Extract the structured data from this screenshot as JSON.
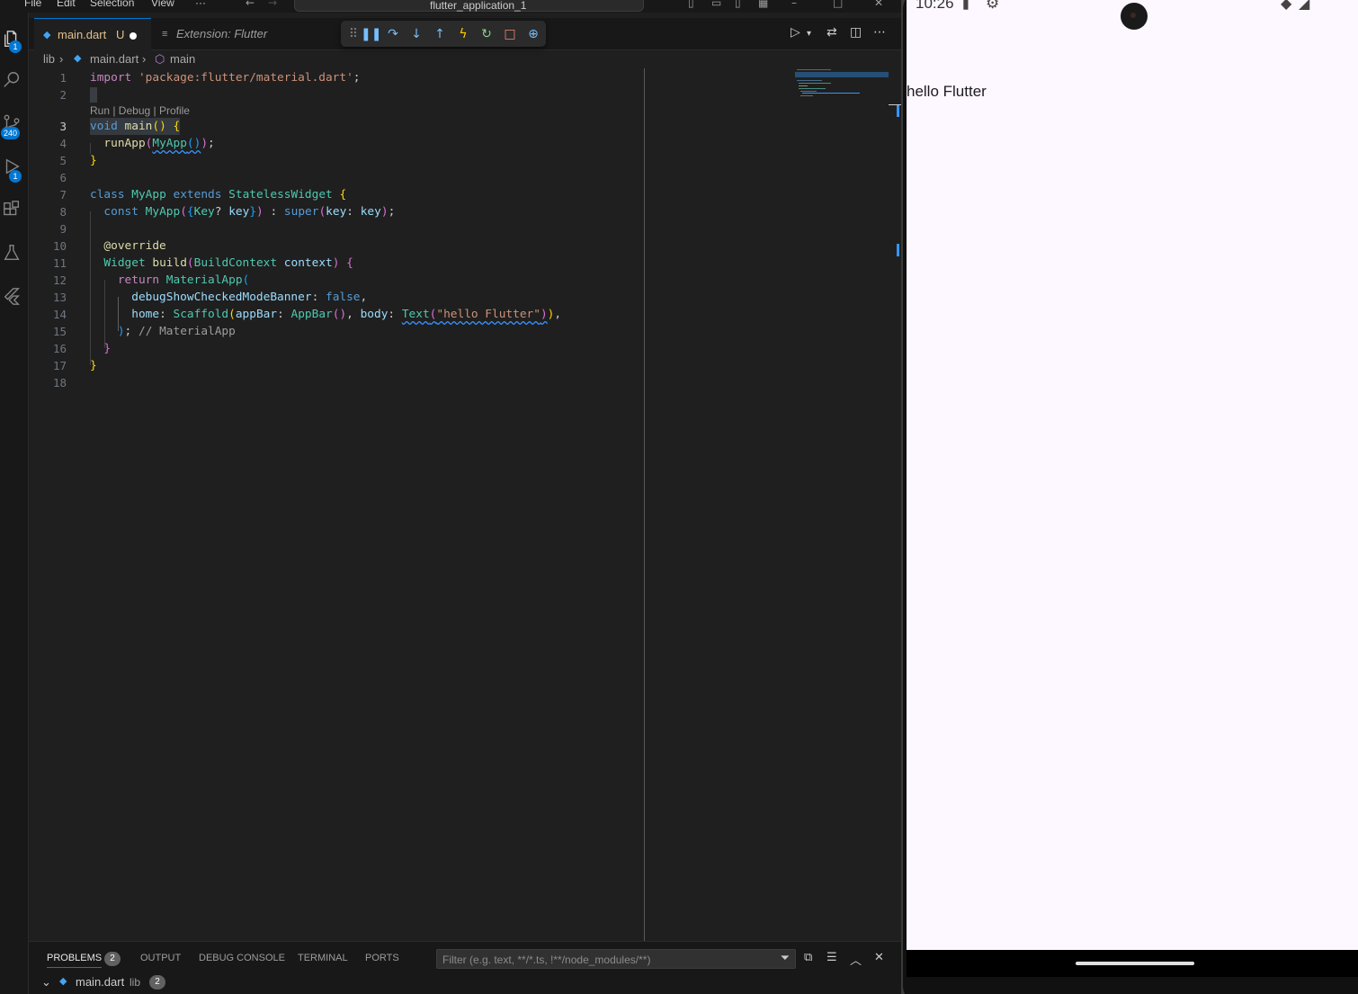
{
  "menu": {
    "file": "File",
    "edit": "Edit",
    "selection": "Selection",
    "view": "View",
    "more": "···"
  },
  "command_center": {
    "label": "flutter_application_1"
  },
  "activity_bar": {
    "explorer_badge": "1",
    "source_control_badge": "240",
    "run_debug_badge": "1"
  },
  "tabs": [
    {
      "label": "main.dart",
      "flag": "U"
    },
    {
      "label": "Extension: Flutter"
    }
  ],
  "breadcrumb": {
    "folder": "lib",
    "file": "main.dart",
    "symbol": "main"
  },
  "codelens": "Run | Debug | Profile",
  "line_numbers": [
    "1",
    "2",
    "3",
    "4",
    "5",
    "6",
    "7",
    "8",
    "9",
    "10",
    "11",
    "12",
    "13",
    "14",
    "15",
    "16",
    "17",
    "18"
  ],
  "code": {
    "l1_kw": "import",
    "l1_str": "'package:flutter/material.dart'",
    "l1_end": ";",
    "l3_kw": "void",
    "l3_fn": "main",
    "l3_paren": "()",
    "l3_brace": "{",
    "l4_fn": "runApp",
    "l4_cls": "MyApp",
    "l4_end": ";",
    "l5": "}",
    "l7_kw": "class",
    "l7_cls": "MyApp",
    "l7_kw2": "extends",
    "l7_cls2": "StatelessWidget",
    "l7_brace": "{",
    "l8_kw": "const",
    "l8_cls": "MyApp",
    "l8_type": "Key",
    "l8_q": "?",
    "l8_var": "key",
    "l8_colon": ":",
    "l8_super": "super",
    "l8_param": "key",
    "l8_var2": "key",
    "l8_end": ";",
    "l10": "@override",
    "l11_cls": "Widget",
    "l11_fn": "build",
    "l11_cls2": "BuildContext",
    "l11_var": "context",
    "l11_brace": "{",
    "l12_kw": "return",
    "l12_cls": "MaterialApp",
    "l13_param": "debugShowCheckedModeBanner",
    "l13_val": "false",
    "l13_end": ",",
    "l14_param": "home",
    "l14_cls": "Scaffold",
    "l14_param2": "appBar",
    "l14_cls2": "AppBar",
    "l14_param3": "body",
    "l14_cls3": "Text",
    "l14_str": "\"hello Flutter\"",
    "l14_end": ",",
    "l15_end": ";",
    "l15_cmt": "// MaterialApp",
    "l16": "}",
    "l17": "}"
  },
  "panel": {
    "tabs": [
      "PROBLEMS",
      "OUTPUT",
      "DEBUG CONSOLE",
      "TERMINAL",
      "PORTS"
    ],
    "problems_count": "2",
    "filter_placeholder": "Filter (e.g. text, **/*.ts, !**/node_modules/**)",
    "row": {
      "file": "main.dart",
      "folder": "lib",
      "count": "2"
    }
  },
  "emulator": {
    "time": "10:26",
    "app_text": "hello Flutter"
  },
  "colors": {
    "accent": "#0078d4",
    "editor_bg": "#1f1f1f",
    "modified_tab": "#e2c08d",
    "app_bg": "#fdf7ff"
  }
}
